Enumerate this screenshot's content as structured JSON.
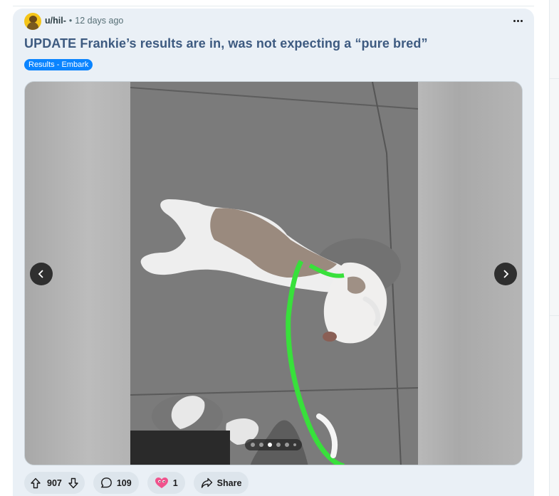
{
  "post": {
    "username": "u/hil-",
    "separator": "•",
    "time_ago": "12 days ago",
    "title": "UPDATE Frankie’s results are in, was not expecting a “pure bred”",
    "flair": "Results - Embark",
    "flair_color": "#0a84ff",
    "title_color": "#3d5a80"
  },
  "gallery": {
    "image_count": 6,
    "current_index": 3
  },
  "actions": {
    "upvotes": "907",
    "comments": "109",
    "awards": "1",
    "share_label": "Share"
  },
  "icons": {
    "avatar": "snoo-avatar-icon",
    "more": "more-options-icon",
    "prev": "chevron-left-icon",
    "next": "chevron-right-icon",
    "upvote": "upvote-arrow-icon",
    "downvote": "downvote-arrow-icon",
    "comment": "comment-bubble-icon",
    "award": "award-heart-icon",
    "share": "share-arrow-icon"
  }
}
